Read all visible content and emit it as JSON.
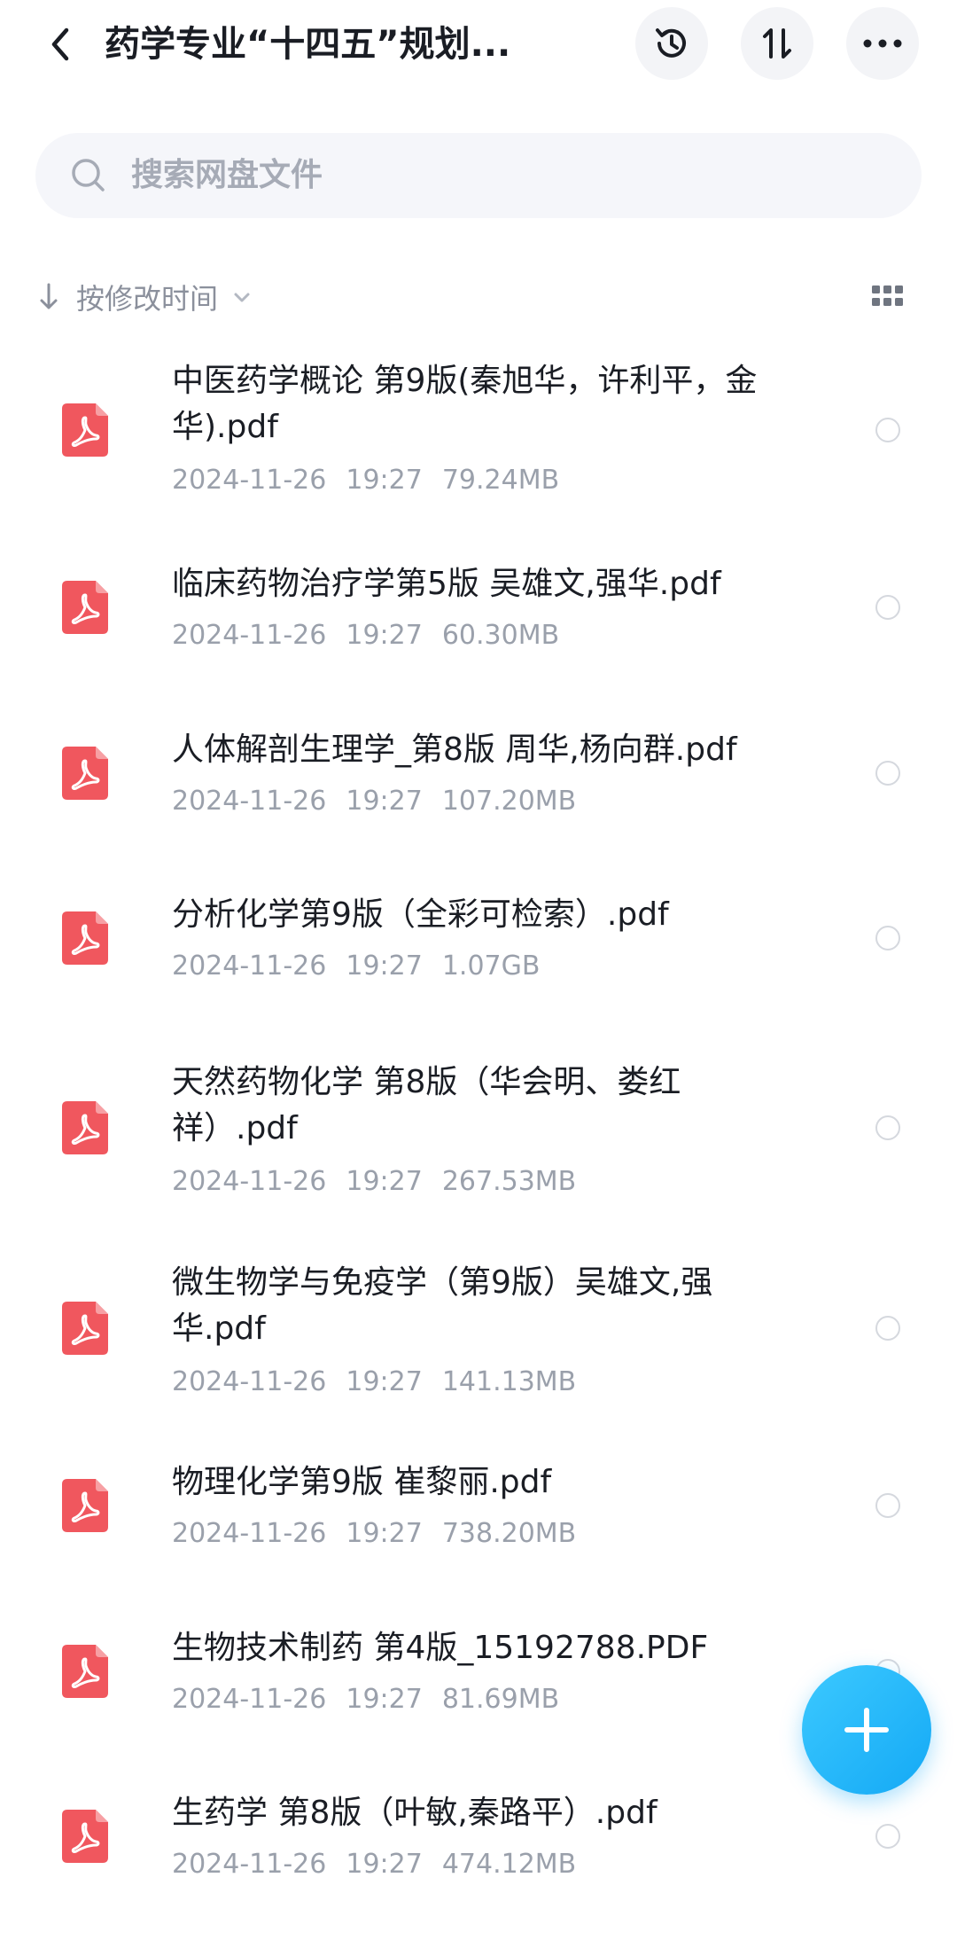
{
  "header": {
    "title": "药学专业“十四五”规划...",
    "back_icon": "chevron-left-icon",
    "history_icon": "history-icon",
    "sort_icon": "sort-arrows-icon",
    "more_icon": "more-dots-icon"
  },
  "search": {
    "placeholder": "搜索网盘文件"
  },
  "sort_bar": {
    "label": "按修改时间",
    "view_toggle_icon": "grid-view-icon"
  },
  "files": [
    {
      "name": "中医药学概论 第9版(秦旭华，许利平，金华).pdf",
      "date": "2024-11-26",
      "time": "19:27",
      "size": "79.24MB"
    },
    {
      "name": "临床药物治疗学第5版 吴雄文,强华.pdf",
      "date": "2024-11-26",
      "time": "19:27",
      "size": "60.30MB"
    },
    {
      "name": "人体解剖生理学_第8版 周华,杨向群.pdf",
      "date": "2024-11-26",
      "time": "19:27",
      "size": "107.20MB"
    },
    {
      "name": "分析化学第9版（全彩可检索）.pdf",
      "date": "2024-11-26",
      "time": "19:27",
      "size": "1.07GB"
    },
    {
      "name": "天然药物化学 第8版（华会明、娄红祥）.pdf",
      "date": "2024-11-26",
      "time": "19:27",
      "size": "267.53MB"
    },
    {
      "name": "微生物学与免疫学（第9版）吴雄文,强华.pdf",
      "date": "2024-11-26",
      "time": "19:27",
      "size": "141.13MB"
    },
    {
      "name": "物理化学第9版 崔黎丽.pdf",
      "date": "2024-11-26",
      "time": "19:27",
      "size": "738.20MB"
    },
    {
      "name": "生物技术制药  第4版_15192788.PDF",
      "date": "2024-11-26",
      "time": "19:27",
      "size": "81.69MB"
    },
    {
      "name": "生药学 第8版（叶敏,秦路平）.pdf",
      "date": "2024-11-26",
      "time": "19:27",
      "size": "474.12MB"
    }
  ],
  "fab": {
    "icon": "plus-icon"
  },
  "colors": {
    "pdf_red": "#f0575e",
    "fab_blue": "#1fb4f8",
    "meta_gray": "#9aa0ab"
  }
}
